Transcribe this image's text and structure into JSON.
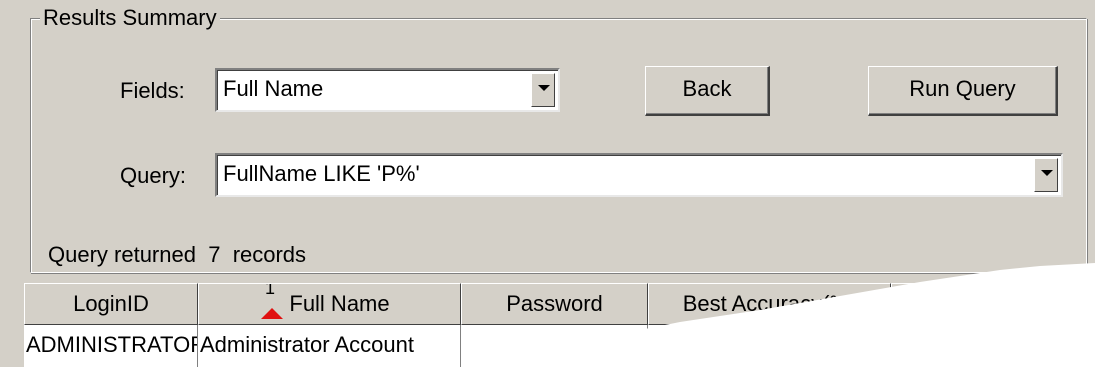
{
  "panel": {
    "legend": "Results Summary"
  },
  "fields": {
    "label": "Fields:",
    "value": "Full Name"
  },
  "query": {
    "label": "Query:",
    "value": "FullName LIKE 'P%'"
  },
  "buttons": {
    "back": "Back",
    "run_query": "Run Query"
  },
  "status": {
    "prefix": "Query returned",
    "count": "7",
    "suffix": "records"
  },
  "table": {
    "columns": [
      "LoginID",
      "Full Name",
      "Password",
      "Best Accuracy(%)"
    ],
    "sort": {
      "column": "Full Name",
      "order_number": "1",
      "direction": "ascending"
    },
    "rows": [
      [
        "ADMINISTRATOR",
        "Administrator Account"
      ]
    ]
  },
  "colors": {
    "window_bg": "#d4d0c8",
    "sort_indicator": "#e01010"
  }
}
